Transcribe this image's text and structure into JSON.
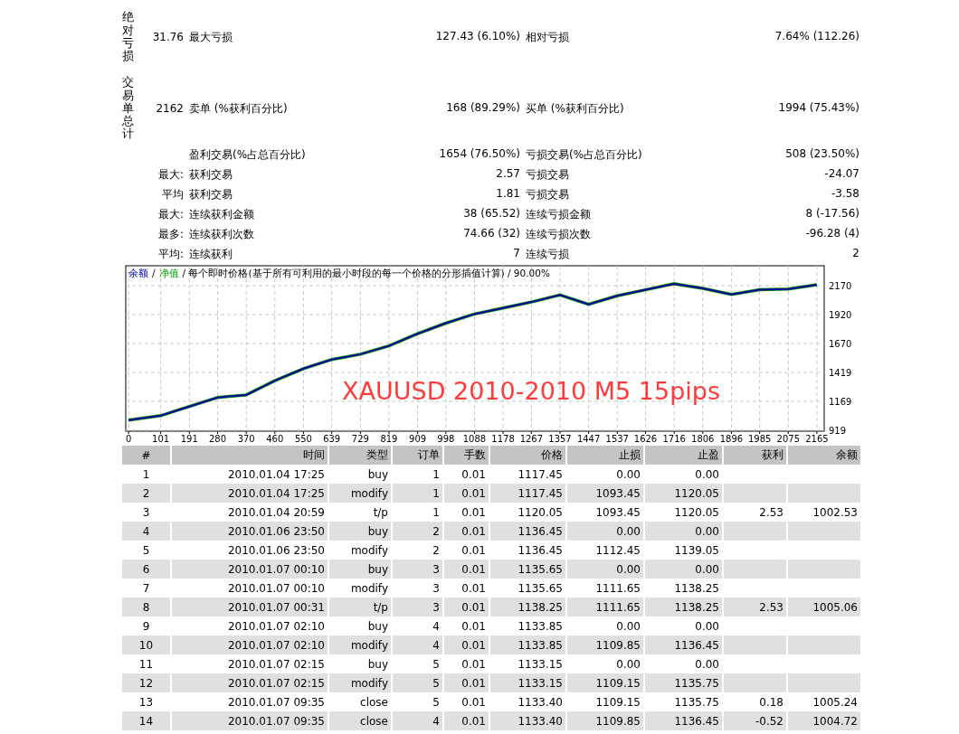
{
  "summary": [
    {
      "side_label": "绝对亏损",
      "lead": "31.76",
      "label_1": "最大亏损",
      "value_1": "127.43 (6.10%)",
      "label_2": "相对亏损",
      "value_2": "7.64% (112.26)"
    },
    {
      "side_label": "交易单总计",
      "lead": "2162",
      "label_1": "卖单 (%获利百分比)",
      "value_1": "168 (89.29%)",
      "label_2": "买单 (%获利百分比)",
      "value_2": "1994 (75.43%)"
    },
    {
      "label_1": "盈利交易(%占总百分比)",
      "value_1": "1654 (76.50%)",
      "label_2": "亏损交易(%占总百分比)",
      "value_2": "508 (23.50%)"
    },
    {
      "lead": "最大:",
      "label_1": "获利交易",
      "value_1": "2.57",
      "label_2": "亏损交易",
      "value_2": "-24.07"
    },
    {
      "lead": "平均",
      "label_1": "获利交易",
      "value_1": "1.81",
      "label_2": "亏损交易",
      "value_2": "-3.58"
    },
    {
      "lead": "最大:",
      "label_1": "连续获利金额",
      "value_1": "38 (65.52)",
      "label_2": "连续亏损金额",
      "value_2": "8 (-17.56)"
    },
    {
      "lead": "最多:",
      "label_1": "连续获利次数",
      "value_1": "74.66 (32)",
      "label_2": "连续亏损次数",
      "value_2": "-96.28 (4)"
    },
    {
      "lead": "平均:",
      "label_1": "连续获利",
      "value_1": "7",
      "label_2": "连续亏损",
      "value_2": "2"
    }
  ],
  "chart": {
    "legend_separator": "/",
    "legend_note": "/ 每个即时价格(基于所有可利用的最小时段的每一个价格的分形插值计算) / 90.00%",
    "chart_data": {
      "type": "line",
      "grid": true,
      "x": [
        0,
        101,
        191,
        280,
        370,
        460,
        550,
        639,
        729,
        819,
        909,
        998,
        1088,
        1178,
        1267,
        1357,
        1447,
        1537,
        1626,
        1716,
        1806,
        1896,
        1985,
        2075,
        2165
      ],
      "series": [
        {
          "name": "余额",
          "color": "#0000a0",
          "values": [
            1006,
            1045,
            1124,
            1202,
            1224,
            1347,
            1452,
            1531,
            1576,
            1649,
            1754,
            1846,
            1925,
            1977,
            2029,
            2090,
            2009,
            2082,
            2135,
            2187,
            2147,
            2095,
            2135,
            2142,
            2179
          ]
        },
        {
          "name": "净值",
          "color": "#00a000",
          "values": [
            1006,
            1045,
            1124,
            1202,
            1224,
            1347,
            1452,
            1531,
            1576,
            1649,
            1754,
            1846,
            1925,
            1977,
            2029,
            2090,
            2009,
            2082,
            2135,
            2187,
            2147,
            2095,
            2135,
            2142,
            2179
          ]
        }
      ],
      "xlim": [
        -9,
        2188
      ],
      "ylim": [
        910,
        2343
      ],
      "xticks": [
        0,
        101,
        191,
        280,
        370,
        460,
        550,
        639,
        729,
        819,
        909,
        998,
        1088,
        1178,
        1267,
        1357,
        1447,
        1537,
        1626,
        1716,
        1806,
        1896,
        1985,
        2075,
        2165
      ],
      "yticks": [
        919,
        1169,
        1419,
        1670,
        1920,
        2170
      ],
      "annotations": [
        "XAUUSD 2010-2010 M5 15pips"
      ]
    }
  },
  "table": {
    "columns": [
      "#",
      "时间",
      "类型",
      "订单",
      "手数",
      "价格",
      "止损",
      "止盈",
      "获利",
      "余额"
    ],
    "rows": [
      [
        "1",
        "2010.01.04 17:25",
        "buy",
        "1",
        "0.01",
        "1117.45",
        "0.00",
        "0.00",
        "",
        ""
      ],
      [
        "2",
        "2010.01.04 17:25",
        "modify",
        "1",
        "0.01",
        "1117.45",
        "1093.45",
        "1120.05",
        "",
        ""
      ],
      [
        "3",
        "2010.01.04 20:59",
        "t/p",
        "1",
        "0.01",
        "1120.05",
        "1093.45",
        "1120.05",
        "2.53",
        "1002.53"
      ],
      [
        "4",
        "2010.01.06 23:50",
        "buy",
        "2",
        "0.01",
        "1136.45",
        "0.00",
        "0.00",
        "",
        ""
      ],
      [
        "5",
        "2010.01.06 23:50",
        "modify",
        "2",
        "0.01",
        "1136.45",
        "1112.45",
        "1139.05",
        "",
        ""
      ],
      [
        "6",
        "2010.01.07 00:10",
        "buy",
        "3",
        "0.01",
        "1135.65",
        "0.00",
        "0.00",
        "",
        ""
      ],
      [
        "7",
        "2010.01.07 00:10",
        "modify",
        "3",
        "0.01",
        "1135.65",
        "1111.65",
        "1138.25",
        "",
        ""
      ],
      [
        "8",
        "2010.01.07 00:31",
        "t/p",
        "3",
        "0.01",
        "1138.25",
        "1111.65",
        "1138.25",
        "2.53",
        "1005.06"
      ],
      [
        "9",
        "2010.01.07 02:10",
        "buy",
        "4",
        "0.01",
        "1133.85",
        "0.00",
        "0.00",
        "",
        ""
      ],
      [
        "10",
        "2010.01.07 02:10",
        "modify",
        "4",
        "0.01",
        "1133.85",
        "1109.85",
        "1136.45",
        "",
        ""
      ],
      [
        "11",
        "2010.01.07 02:15",
        "buy",
        "5",
        "0.01",
        "1133.15",
        "0.00",
        "0.00",
        "",
        ""
      ],
      [
        "12",
        "2010.01.07 02:15",
        "modify",
        "5",
        "0.01",
        "1133.15",
        "1109.15",
        "1135.75",
        "",
        ""
      ],
      [
        "13",
        "2010.01.07 09:35",
        "close",
        "5",
        "0.01",
        "1133.40",
        "1109.15",
        "1135.75",
        "0.18",
        "1005.24"
      ],
      [
        "14",
        "2010.01.07 09:35",
        "close",
        "4",
        "0.01",
        "1133.40",
        "1109.85",
        "1136.45",
        "-0.52",
        "1004.72"
      ]
    ]
  }
}
